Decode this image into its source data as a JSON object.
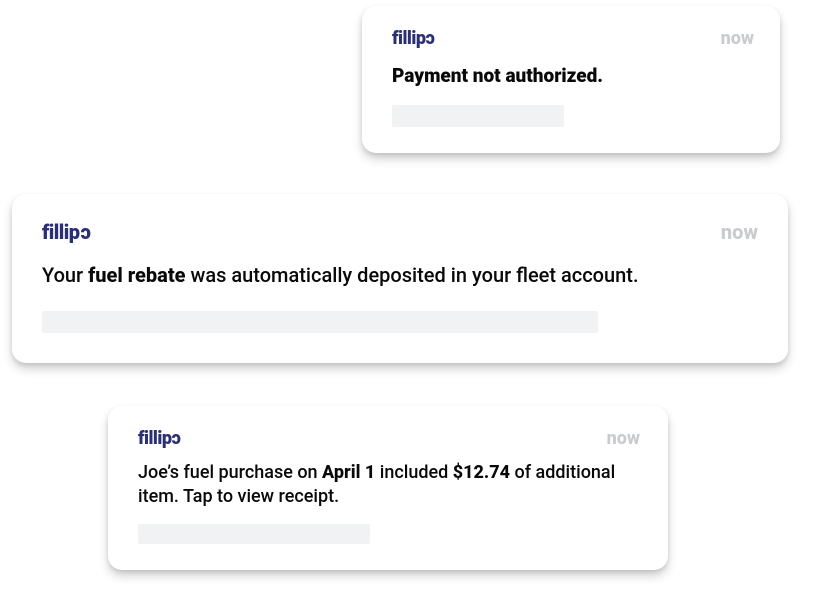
{
  "brand": "fillip",
  "notifications": [
    {
      "timestamp": "now",
      "title_html": "<b>Payment not authorized.</b>"
    },
    {
      "timestamp": "now",
      "title_html": "Your <b>fuel rebate</b> was automatically deposited in your fleet account."
    },
    {
      "timestamp": "now",
      "title_html": "Joe’s fuel purchase on <b>April 1</b> included <b>$12.74</b> of additional item. Tap to view receipt."
    }
  ]
}
